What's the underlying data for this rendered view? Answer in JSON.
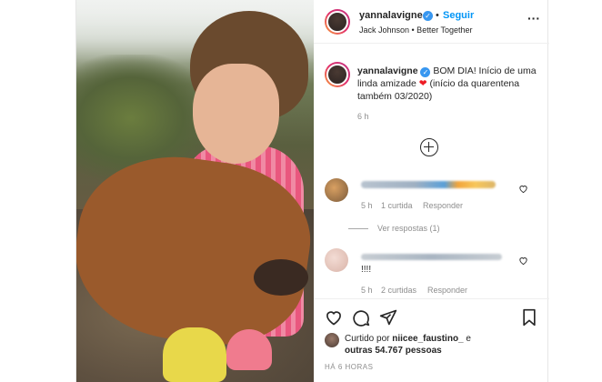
{
  "post": {
    "username": "yannalavigne",
    "follow_label": "Seguir",
    "separator": "•",
    "song": "Jack Johnson • Better Together",
    "caption_username": "yannalavigne",
    "caption_text": "BOM DIA! Início de uma linda amizade",
    "caption_heart": "❤",
    "caption_rest": "(início da quarentena também 03/2020)",
    "caption_time": "6 h",
    "accent_color": "#0095f6",
    "verified_color": "#3897f0"
  },
  "comments": [
    {
      "meta_time": "5 h",
      "meta_likes": "1 curtida",
      "meta_reply": "Responder",
      "text": ""
    },
    {
      "meta_time": "5 h",
      "meta_likes": "2 curtidas",
      "meta_reply": "Responder",
      "text": "!!!!"
    }
  ],
  "replies_label": "Ver respostas (1)",
  "footer": {
    "liked_prefix": "Curtido por",
    "liked_user": "niicee_faustino_",
    "liked_conj": "e",
    "liked_others": "outras 54.767 pessoas",
    "post_time": "HÁ 6 HORAS"
  },
  "icons": {
    "plus": "plus-circle-icon",
    "heart": "heart-outline-icon",
    "comment": "comment-bubble-icon",
    "share": "send-paper-plane-icon",
    "save": "bookmark-icon",
    "more": "more-options-icon"
  }
}
